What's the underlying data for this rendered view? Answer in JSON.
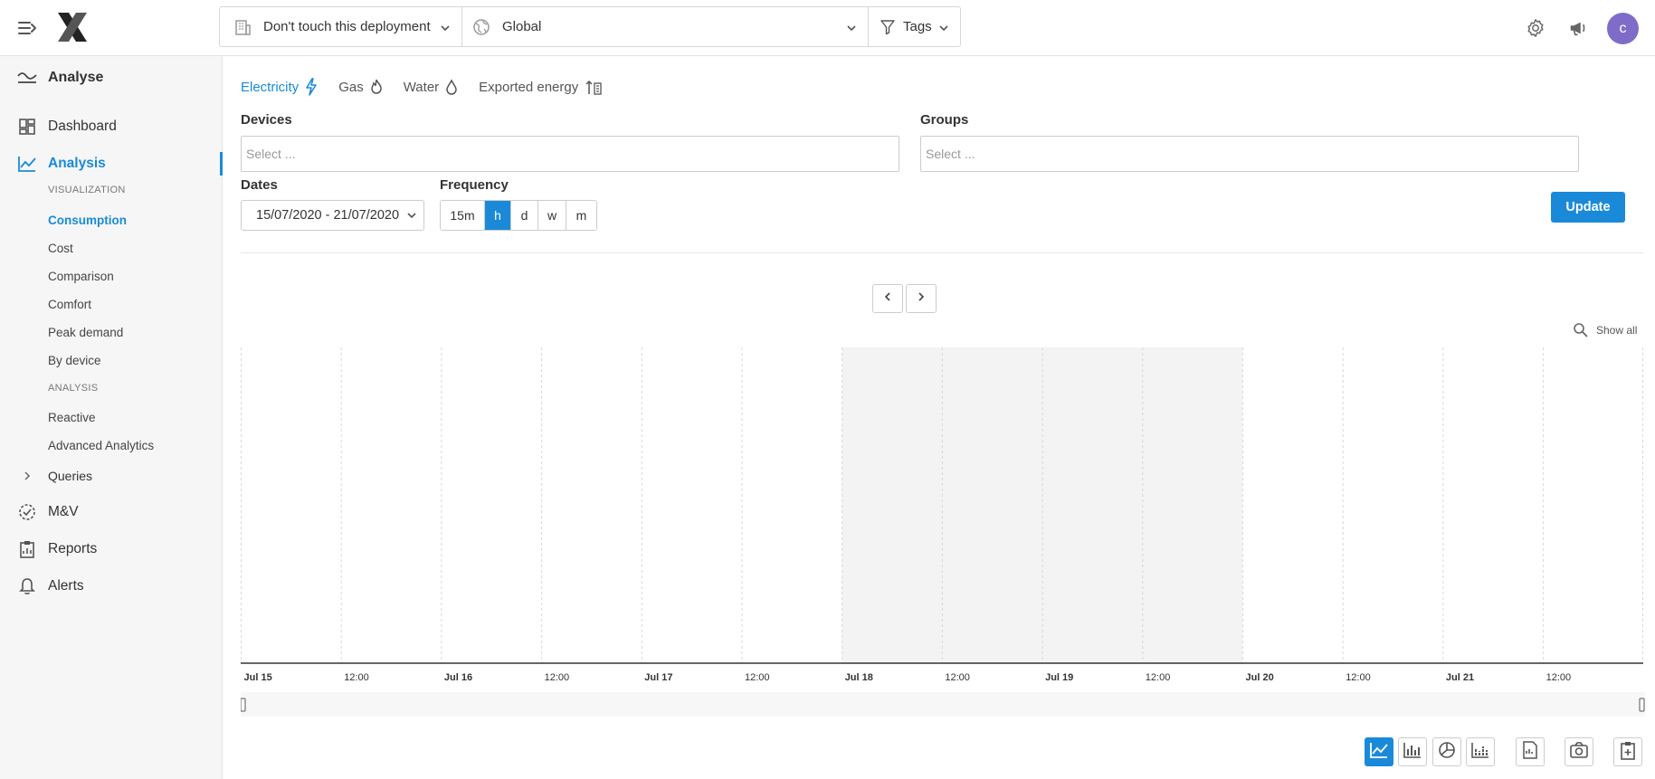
{
  "topbar": {
    "deployment": "Don't touch this deployment",
    "scope": "Global",
    "tags": "Tags",
    "avatar_initial": "c"
  },
  "sidebar": {
    "header": "Analyse",
    "items": [
      {
        "label": "Dashboard",
        "icon": "dashboard-icon"
      },
      {
        "label": "Analysis",
        "icon": "analysis-chart-icon",
        "active": true
      },
      {
        "label": "Queries",
        "icon": "chevron-right-icon"
      },
      {
        "label": "M&V",
        "icon": "check-circle-icon"
      },
      {
        "label": "Reports",
        "icon": "clipboard-icon"
      },
      {
        "label": "Alerts",
        "icon": "bell-icon"
      }
    ],
    "section_visualization": "VISUALIZATION",
    "visualization": [
      "Consumption",
      "Cost",
      "Comparison",
      "Comfort",
      "Peak demand",
      "By device"
    ],
    "section_analysis": "ANALYSIS",
    "analysis": [
      "Reactive",
      "Advanced Analytics"
    ]
  },
  "tabs": [
    {
      "label": "Electricity",
      "icon": "lightning-icon",
      "active": true
    },
    {
      "label": "Gas",
      "icon": "flame-icon"
    },
    {
      "label": "Water",
      "icon": "drop-icon"
    },
    {
      "label": "Exported energy",
      "icon": "exported-energy-icon"
    }
  ],
  "filters": {
    "devices_label": "Devices",
    "devices_placeholder": "Select ...",
    "groups_label": "Groups",
    "groups_placeholder": "Select ...",
    "dates_label": "Dates",
    "dates_value": "15/07/2020 - 21/07/2020",
    "frequency_label": "Frequency",
    "frequency_options": [
      "15m",
      "h",
      "d",
      "w",
      "m"
    ],
    "frequency_selected": "h",
    "update_label": "Update"
  },
  "chart": {
    "show_all": "Show all"
  },
  "chart_data": {
    "type": "line",
    "series": [],
    "x_ticks": [
      "Jul 15",
      "12:00",
      "Jul 16",
      "12:00",
      "Jul 17",
      "12:00",
      "Jul 18",
      "12:00",
      "Jul 19",
      "12:00",
      "Jul 20",
      "12:00",
      "Jul 21",
      "12:00"
    ],
    "x_range": [
      "2020-07-15",
      "2020-07-21"
    ],
    "shaded_range": [
      "Jul 18",
      "Jul 20"
    ],
    "grid": true
  }
}
